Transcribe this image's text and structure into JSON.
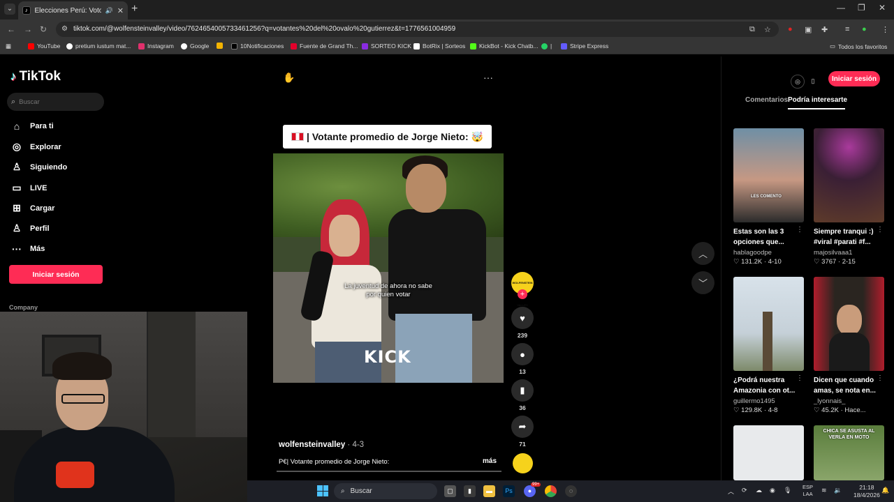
{
  "browser": {
    "tab_title": "Elecciones Perú: Voto por J",
    "url": "tiktok.com/@wolfensteinvalley/video/7624654005733461256?q=votantes%20del%20ovalo%20gutierrez&t=1776561004959"
  },
  "bookmarks": [
    {
      "label": "YouTube",
      "color": "#ff0000"
    },
    {
      "label": "pretium iustum mat...",
      "color": "#ffffff"
    },
    {
      "label": "Instagram",
      "color": "#e1306c"
    },
    {
      "label": "Google",
      "color": "#4285f4"
    },
    {
      "label": "",
      "color": "#f4b400"
    },
    {
      "label": "10Notificaciones",
      "color": "#000000"
    },
    {
      "label": "Fuente de Grand Th...",
      "color": "#e4002b"
    },
    {
      "label": "SORTEO KICK",
      "color": "#8a2be2"
    },
    {
      "label": "BotRix | Sorteos",
      "color": "#ffffff"
    },
    {
      "label": "KickBot - Kick Chatb...",
      "color": "#53fc18"
    },
    {
      "label": "|",
      "color": "#25d366"
    },
    {
      "label": "Stripe Express",
      "color": "#635bff"
    }
  ],
  "bookmarks_all": "Todos los favoritos",
  "tiktok": {
    "logo": "TikTok",
    "search_placeholder": "Buscar",
    "nav": [
      "Para ti",
      "Explorar",
      "Siguiendo",
      "LIVE",
      "Cargar",
      "Perfil",
      "Más"
    ],
    "login": "Iniciar sesión",
    "company": "Company"
  },
  "video": {
    "title": "| Votante promedio de Jorge Nieto: 🤯",
    "subtitle_line1": "La juventud de ahora no sabe",
    "subtitle_line2": "por quien votar",
    "watermark": "KICK",
    "avatar_text": "WOLFENSTEIN VALLEY",
    "likes": "239",
    "comments": "13",
    "saves": "36",
    "shares": "71",
    "author": "wolfensteinvalley",
    "date": " · 4-3",
    "description": "P€| Votante promedio de Jorge Nieto:",
    "more": "más"
  },
  "right_panel": {
    "login": "Iniciar sesión",
    "tab_comments": "Comentarios",
    "tab_suggested": "Podría interesarte",
    "cards": [
      {
        "caption": "Estas son las 3 opciones que...",
        "user": "hablagoodpe",
        "stats": "♡ 131.2K · 4-10",
        "overlay": "LES COMENTO"
      },
      {
        "caption": "Siempre tranqui :) #viral #parati #f...",
        "user": "majosilvaaa1",
        "stats": "♡ 3767 · 2-15",
        "overlay": ""
      },
      {
        "caption": "¿Podrá nuestra Amazonia con ot...",
        "user": "guillermo1495",
        "stats": "♡ 129.8K · 4-8",
        "overlay": ""
      },
      {
        "caption": "Dicen que cuando amas, se nota en...",
        "user": "_lyonnais_",
        "stats": "♡ 45.2K · Hace...",
        "overlay": ""
      },
      {
        "caption": "",
        "user": "",
        "stats": "",
        "overlay": ""
      },
      {
        "caption": "",
        "user": "",
        "stats": "",
        "overlay": "CHICA SE ASUSTA AL VERLA EN MOTO"
      }
    ]
  },
  "taskbar": {
    "search": "Buscar",
    "lang": "ESP",
    "lang2": "LAA",
    "time": "21:18",
    "date": "18/4/2026",
    "badge": "99+"
  }
}
